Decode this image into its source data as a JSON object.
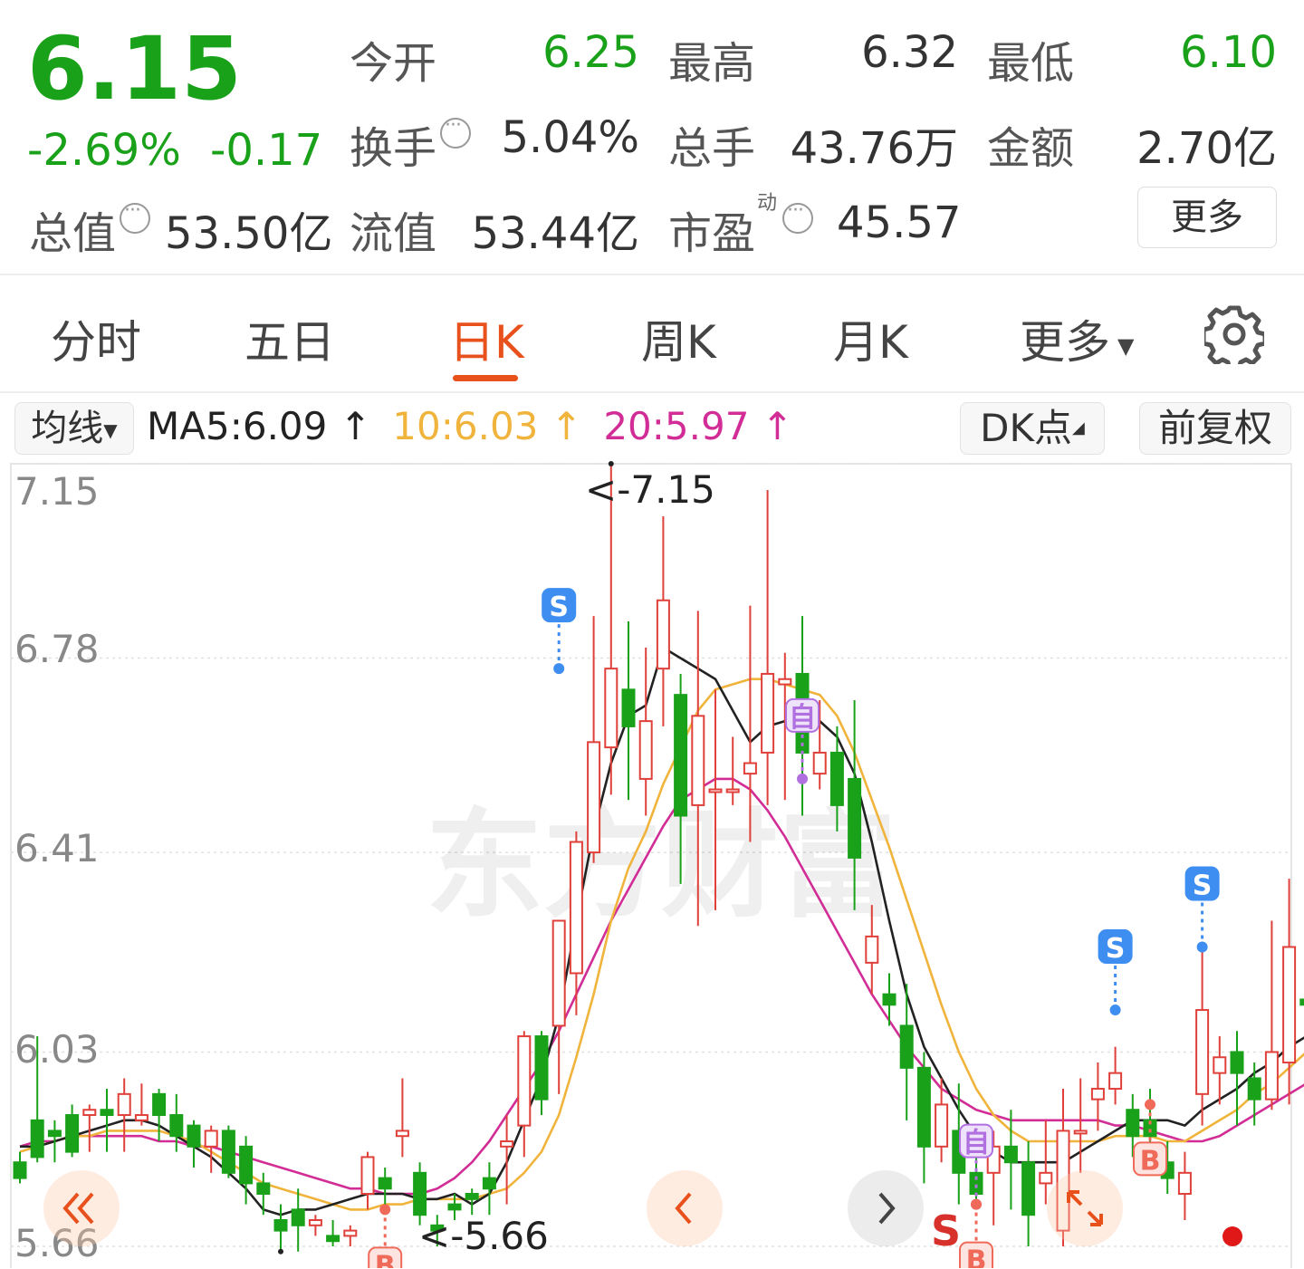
{
  "header": {
    "price": "6.15",
    "change_pct": "-2.69%",
    "change": "-0.17",
    "open_label": "今开",
    "open": "6.25",
    "high_label": "最高",
    "high": "6.32",
    "low_label": "最低",
    "low": "6.10",
    "turnover_label": "换手",
    "turnover": "5.04%",
    "volume_label": "总手",
    "volume": "43.76万",
    "amount_label": "金额",
    "amount": "2.70亿",
    "mktcap_label": "总值",
    "mktcap": "53.50亿",
    "float_label": "流值",
    "float_cap": "53.44亿",
    "pe_label": "市盈",
    "pe_sup": "动",
    "pe": "45.57",
    "more_button": "更多"
  },
  "tabs": [
    "分时",
    "五日",
    "日K",
    "周K",
    "月K",
    "更多"
  ],
  "active_tab": 2,
  "indicator_bar": {
    "ma_select": "均线",
    "ma5": "MA5:6.09",
    "ma10": "10:6.03",
    "ma20": "20:5.97",
    "up_arrow": "↑",
    "dk_button": "DK点",
    "adjust_button": "前复权"
  },
  "colors": {
    "up": "#e0403a",
    "down": "#1aa11a",
    "ma5": "#222222",
    "ma10": "#f0b43c",
    "ma20": "#d22d96",
    "accent": "#e8501c"
  },
  "icons": {
    "settings": "gear-icon",
    "prev_fast": "double-chevron-left-icon",
    "prev": "chevron-left-icon",
    "next": "chevron-right-icon",
    "expand": "expand-icon"
  },
  "chart_data": {
    "type": "candlestick",
    "ylim": [
      5.66,
      7.15
    ],
    "y_ticks": [
      "7.15",
      "6.78",
      "6.41",
      "6.03",
      "5.66"
    ],
    "max_label": "<-7.15",
    "min_label": "<-5.66",
    "candles": [
      [
        5.82,
        5.79,
        5.84,
        5.78
      ],
      [
        5.9,
        5.83,
        6.06,
        5.82
      ],
      [
        5.88,
        5.87,
        5.9,
        5.82
      ],
      [
        5.91,
        5.84,
        5.93,
        5.83
      ],
      [
        5.91,
        5.92,
        5.93,
        5.84
      ],
      [
        5.92,
        5.91,
        5.96,
        5.84
      ],
      [
        5.91,
        5.95,
        5.98,
        5.84
      ],
      [
        5.9,
        5.91,
        5.97,
        5.89
      ],
      [
        5.95,
        5.91,
        5.96,
        5.86
      ],
      [
        5.91,
        5.87,
        5.95,
        5.84
      ],
      [
        5.89,
        5.85,
        5.9,
        5.81
      ],
      [
        5.85,
        5.88,
        5.89,
        5.8
      ],
      [
        5.88,
        5.8,
        5.89,
        5.79
      ],
      [
        5.85,
        5.78,
        5.87,
        5.74
      ],
      [
        5.78,
        5.76,
        5.8,
        5.72
      ],
      [
        5.71,
        5.69,
        5.74,
        5.65
      ],
      [
        5.73,
        5.7,
        5.77,
        5.65
      ],
      [
        5.7,
        5.71,
        5.72,
        5.68
      ],
      [
        5.68,
        5.67,
        5.71,
        5.66
      ],
      [
        5.68,
        5.69,
        5.7,
        5.66
      ],
      [
        5.76,
        5.83,
        5.84,
        5.73
      ],
      [
        5.79,
        5.77,
        5.81,
        5.73
      ],
      [
        5.87,
        5.88,
        5.98,
        5.83
      ],
      [
        5.8,
        5.72,
        5.82,
        5.7
      ],
      [
        5.7,
        5.69,
        5.72,
        5.66
      ],
      [
        5.74,
        5.73,
        5.76,
        5.71
      ],
      [
        5.76,
        5.75,
        5.77,
        5.72
      ],
      [
        5.79,
        5.77,
        5.82,
        5.72
      ],
      [
        5.85,
        5.86,
        5.91,
        5.74
      ],
      [
        5.89,
        6.06,
        6.07,
        5.83
      ],
      [
        6.06,
        5.94,
        6.07,
        5.91
      ],
      [
        6.08,
        6.28,
        6.28,
        5.95
      ],
      [
        6.18,
        6.43,
        6.45,
        6.1
      ],
      [
        6.41,
        6.62,
        6.86,
        6.39
      ],
      [
        6.61,
        6.76,
        7.15,
        6.52
      ],
      [
        6.72,
        6.65,
        6.85,
        6.51
      ],
      [
        6.55,
        6.66,
        6.8,
        6.48
      ],
      [
        6.76,
        6.89,
        7.05,
        6.65
      ],
      [
        6.71,
        6.48,
        6.75,
        6.35
      ],
      [
        6.5,
        6.67,
        6.87,
        6.27
      ],
      [
        6.53,
        6.53,
        6.72,
        6.3
      ],
      [
        6.53,
        6.53,
        6.63,
        6.5
      ],
      [
        6.56,
        6.58,
        6.88,
        6.43
      ],
      [
        6.6,
        6.75,
        7.1,
        6.5
      ],
      [
        6.73,
        6.74,
        6.79,
        6.51
      ],
      [
        6.75,
        6.6,
        6.86,
        6.48
      ],
      [
        6.56,
        6.6,
        6.7,
        6.53
      ],
      [
        6.6,
        6.5,
        6.65,
        6.45
      ],
      [
        6.55,
        6.4,
        6.7,
        6.3
      ],
      [
        6.2,
        6.25,
        6.31,
        6.14
      ],
      [
        6.14,
        6.12,
        6.18,
        6.08
      ],
      [
        6.08,
        6.0,
        6.16,
        5.9
      ],
      [
        6.0,
        5.85,
        6.03,
        5.78
      ],
      [
        5.85,
        5.93,
        5.98,
        5.82
      ],
      [
        5.88,
        5.8,
        5.97,
        5.74
      ],
      [
        5.8,
        5.76,
        5.84,
        5.74
      ],
      [
        5.8,
        5.85,
        5.88,
        5.7
      ],
      [
        5.85,
        5.82,
        5.92,
        5.73
      ],
      [
        5.82,
        5.72,
        5.86,
        5.66
      ],
      [
        5.78,
        5.8,
        5.9,
        5.74
      ],
      [
        5.69,
        5.88,
        5.96,
        5.66
      ],
      [
        5.88,
        5.88,
        5.98,
        5.8
      ],
      [
        5.94,
        5.96,
        6.01,
        5.88
      ],
      [
        5.96,
        5.99,
        6.04,
        5.93
      ],
      [
        5.92,
        5.87,
        5.95,
        5.83
      ],
      [
        5.9,
        5.87,
        5.96,
        5.8
      ],
      [
        5.82,
        5.79,
        5.86,
        5.76
      ],
      [
        5.76,
        5.8,
        5.84,
        5.71
      ],
      [
        5.95,
        6.11,
        6.24,
        5.89
      ],
      [
        5.99,
        6.02,
        6.06,
        5.93
      ],
      [
        6.03,
        5.99,
        6.07,
        5.89
      ],
      [
        5.98,
        5.94,
        6.01,
        5.89
      ],
      [
        5.94,
        6.03,
        6.28,
        5.92
      ],
      [
        6.01,
        6.23,
        6.36,
        5.93
      ],
      [
        6.13,
        6.12,
        6.21,
        6.02
      ]
    ],
    "ma5": [
      5.85,
      5.85,
      5.86,
      5.87,
      5.88,
      5.89,
      5.9,
      5.9,
      5.89,
      5.87,
      5.85,
      5.83,
      5.8,
      5.77,
      5.73,
      5.72,
      5.73,
      5.73,
      5.74,
      5.75,
      5.76,
      5.76,
      5.76,
      5.75,
      5.75,
      5.76,
      5.74,
      5.76,
      5.82,
      5.9,
      5.98,
      6.1,
      6.28,
      6.45,
      6.58,
      6.67,
      6.69,
      6.8,
      6.78,
      6.76,
      6.74,
      6.68,
      6.62,
      6.65,
      6.66,
      6.66,
      6.66,
      6.63,
      6.56,
      6.43,
      6.28,
      6.14,
      6.04,
      5.98,
      5.92,
      5.87,
      5.84,
      5.82,
      5.82,
      5.82,
      5.82,
      5.84,
      5.86,
      5.88,
      5.9,
      5.9,
      5.9,
      5.89,
      5.92,
      5.94,
      5.96,
      5.99,
      6.01,
      6.04,
      6.06
    ],
    "ma10": [
      5.84,
      5.85,
      5.86,
      5.87,
      5.87,
      5.88,
      5.88,
      5.88,
      5.88,
      5.87,
      5.86,
      5.84,
      5.82,
      5.8,
      5.78,
      5.77,
      5.76,
      5.75,
      5.74,
      5.73,
      5.73,
      5.74,
      5.74,
      5.75,
      5.75,
      5.75,
      5.75,
      5.76,
      5.77,
      5.8,
      5.84,
      5.91,
      6.02,
      6.14,
      6.28,
      6.38,
      6.45,
      6.54,
      6.61,
      6.68,
      6.72,
      6.73,
      6.74,
      6.74,
      6.73,
      6.72,
      6.71,
      6.67,
      6.6,
      6.51,
      6.42,
      6.32,
      6.22,
      6.12,
      6.03,
      5.96,
      5.91,
      5.88,
      5.86,
      5.86,
      5.86,
      5.86,
      5.86,
      5.87,
      5.87,
      5.87,
      5.86,
      5.86,
      5.88,
      5.9,
      5.92,
      5.95,
      5.97,
      6.0,
      6.03
    ],
    "ma20": [
      5.85,
      5.86,
      5.86,
      5.87,
      5.87,
      5.87,
      5.87,
      5.87,
      5.86,
      5.86,
      5.85,
      5.85,
      5.84,
      5.83,
      5.82,
      5.81,
      5.8,
      5.79,
      5.78,
      5.77,
      5.77,
      5.76,
      5.76,
      5.76,
      5.77,
      5.79,
      5.82,
      5.86,
      5.91,
      5.96,
      6.01,
      6.07,
      6.14,
      6.21,
      6.28,
      6.34,
      6.4,
      6.46,
      6.51,
      6.53,
      6.55,
      6.55,
      6.53,
      6.49,
      6.44,
      6.38,
      6.32,
      6.26,
      6.2,
      6.14,
      6.09,
      6.04,
      6.0,
      5.96,
      5.94,
      5.92,
      5.91,
      5.9,
      5.9,
      5.9,
      5.9,
      5.9,
      5.9,
      5.89,
      5.89,
      5.88,
      5.87,
      5.86,
      5.86,
      5.87,
      5.89,
      5.91,
      5.93,
      5.95,
      5.97
    ],
    "markers": [
      {
        "index": 21,
        "label": "B",
        "kind": "buy",
        "price": 5.73
      },
      {
        "index": 31,
        "label": "S",
        "kind": "sell",
        "price": 6.76
      },
      {
        "index": 45,
        "label": "自",
        "kind": "self",
        "price": 6.55
      },
      {
        "index": 55,
        "label": "自",
        "kind": "self",
        "price": 5.74
      },
      {
        "index": 55,
        "label": "B",
        "kind": "buy",
        "price": 5.74
      },
      {
        "index": 63,
        "label": "S",
        "kind": "sell",
        "price": 6.11
      },
      {
        "index": 65,
        "label": "B",
        "kind": "buy",
        "price": 5.93
      },
      {
        "index": 68,
        "label": "S",
        "kind": "sell",
        "price": 6.23
      }
    ],
    "bottom_sell_label": "S"
  }
}
